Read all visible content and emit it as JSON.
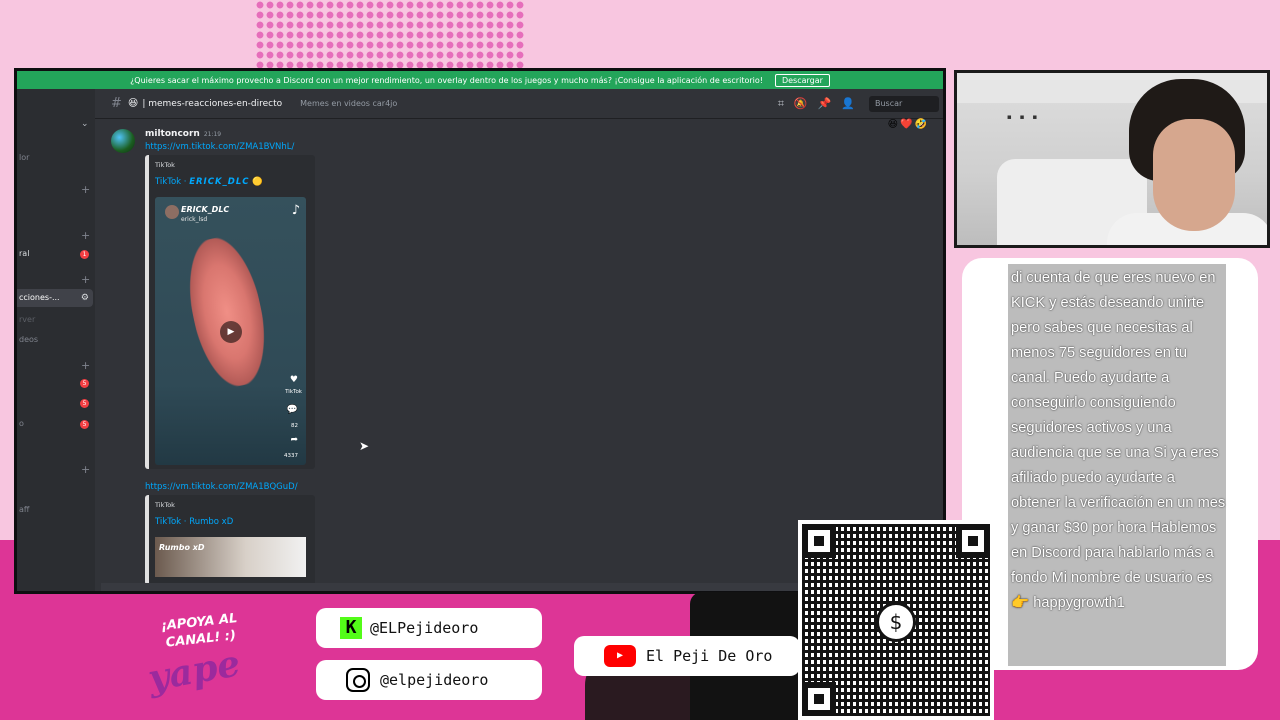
{
  "discord": {
    "banner": {
      "text": "¿Quieres sacar el máximo provecho a Discord con un mejor rendimiento, un overlay dentro de los juegos y mucho más? ¡Consigue la aplicación de escritorio!",
      "os_icons": "  ",
      "download_label": "Descargar"
    },
    "sidebar": {
      "fragments": [
        "lor",
        "ral",
        "cciones-...",
        "rver",
        "deos",
        "o",
        "aff"
      ],
      "active_channel": "cciones-...",
      "badges": [
        "1",
        "5",
        "5",
        "5"
      ]
    },
    "channel": {
      "emoji": "😆",
      "name": "| memes-reacciones-en-directo",
      "topic": "Memes en videos car4jo"
    },
    "search_placeholder": "Buscar",
    "message": {
      "author": "miltoncorn",
      "time": "21:19",
      "link1": "https://vm.tiktok.com/ZMA1BVNhL/",
      "link2": "https://vm.tiktok.com/ZMA1BQGuD/",
      "embed1": {
        "provider": "TikTok",
        "title_prefix": "TikTok · ",
        "title_user": "ERICK_DLC",
        "video_user": "ERICK_DLC",
        "video_handle": "erick_lsd",
        "watermark": "TikTok",
        "comments": "82",
        "shares": "4337"
      },
      "embed2": {
        "provider": "TikTok",
        "title": "TikTok · Rumbo xD",
        "video_user": "Rumbo xD"
      }
    }
  },
  "overlay": {
    "chat_message": "di cuenta de que eres nuevo en KICK y estás deseando unirte pero sabes que necesitas al menos 75 seguidores en tu canal. Puedo ayudarte a conseguirlo consiguiendo seguidores activos y una audiencia que se una Si ya eres afiliado puedo ayudarte a obtener la verificación en un mes y ganar $30 por hora Hablemos en Discord para hablarlo más a fondo Mi nombre de usuario es 👉 happygrowth1",
    "kick": "@ELPejideoro",
    "instagram": "@elpejideoro",
    "youtube": "El Peji De Oro",
    "apoya": "¡APOYA AL CANAL! :)",
    "yape": "yape",
    "qr_symbol": "$"
  },
  "colors": {
    "background_pink": "#f8c6e0",
    "band_magenta": "#dd3596",
    "discord_green": "#23a55a",
    "discord_bg": "#313338",
    "link_blue": "#00a8fc",
    "kick_green": "#53fc18",
    "youtube_red": "#ff0000"
  }
}
